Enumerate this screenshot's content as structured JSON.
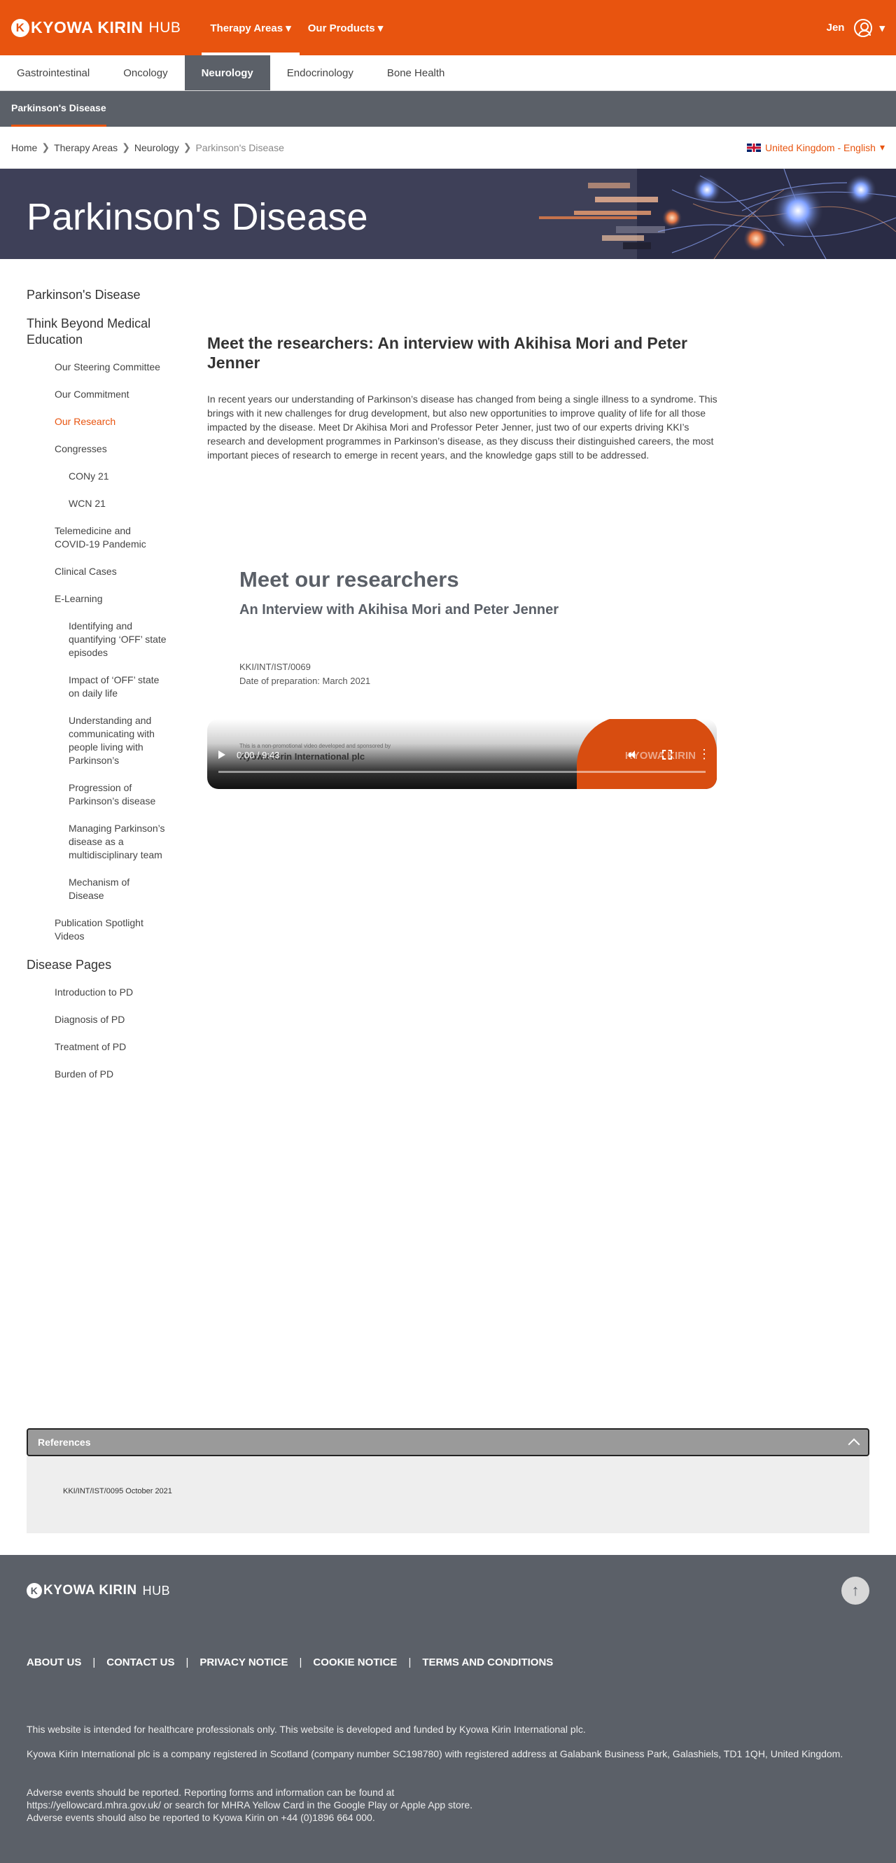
{
  "header": {
    "logo_brand": "KYOWA KIRIN",
    "logo_hub": "HUB",
    "nav": [
      {
        "label": "Therapy Areas ▾"
      },
      {
        "label": "Our Products ▾"
      }
    ],
    "user_name": "Jen",
    "user_caret": "▾"
  },
  "therapy_tabs": [
    "Gastrointestinal",
    "Oncology",
    "Neurology",
    "Endocrinology",
    "Bone Health"
  ],
  "subnav": {
    "item": "Parkinson's Disease"
  },
  "breadcrumb": {
    "items": [
      "Home",
      "Therapy Areas",
      "Neurology"
    ],
    "current": "Parkinson's Disease",
    "sep": "❯"
  },
  "locale": {
    "label": "United Kingdom - English",
    "caret": "▾"
  },
  "hero": {
    "title": "Parkinson's Disease"
  },
  "sidebar": {
    "parkinsons": "Parkinson's Disease",
    "think_beyond": "Think Beyond Medical Education",
    "steering": "Our Steering Committee",
    "commitment": "Our Commitment",
    "research": "Our Research",
    "congresses": "Congresses",
    "cony21": "CONy 21",
    "wcn21": "WCN 21",
    "telemedicine": "Telemedicine and COVID-19 Pandemic",
    "clinical_cases": "Clinical Cases",
    "elearning": "E-Learning",
    "el1": "Identifying and quantifying ‘OFF’ state episodes",
    "el2": "Impact of ‘OFF’ state on daily life",
    "el3": "Understanding and communicating with people living with Parkinson’s",
    "el4": "Progression of Parkinson’s disease",
    "el5": "Managing Parkinson’s disease as a multidisciplinary team",
    "el6": "Mechanism of Disease",
    "pub_spotlight": "Publication Spotlight Videos",
    "disease_pages": "Disease Pages",
    "intro_pd": "Introduction to PD",
    "diagnosis_pd": "Diagnosis of PD",
    "treatment_pd": "Treatment of PD",
    "burden_pd": "Burden of PD"
  },
  "article": {
    "title": "Meet the researchers: An interview with Akihisa Mori and Peter Jenner",
    "body": "In recent years our understanding of Parkinson’s disease has changed from being a single illness to a syndrome. This brings with it new challenges for drug development, but also new opportunities to improve quality of life for all those impacted by the disease. Meet Dr Akihisa Mori and Professor Peter Jenner, just two of our experts driving KKI’s research and development programmes in Parkinson’s disease, as they discuss their distinguished careers, the most important pieces of research to emerge in recent years, and the knowledge gaps still to be addressed."
  },
  "video": {
    "title": "Meet our researchers",
    "subtitle": "An Interview with Akihisa Mori and Peter Jenner",
    "code": "KKI/INT/IST/0069",
    "date": "Date of preparation: March 2021",
    "disclaimer": "This is a non-promotional video developed and sponsored by",
    "sponsor": "Kyowa Kirin International plc",
    "time": "0:00 / 9:43",
    "watermark": "KYOWA KIRIN",
    "progress": 0
  },
  "references": {
    "label": "References",
    "text": "KKI/INT/IST/0095 October 2021"
  },
  "footer": {
    "logo_brand": "KYOWA KIRIN",
    "logo_hub": "HUB",
    "top_arrow": "↑",
    "links": [
      "ABOUT US",
      "CONTACT US",
      "PRIVACY NOTICE",
      "COOKIE NOTICE",
      "TERMS AND CONDITIONS"
    ],
    "sep": "|",
    "p1": "This website is intended for healthcare professionals only. This website is developed and funded by Kyowa Kirin International plc.",
    "p2": "Kyowa Kirin International plc is a company registered in Scotland (company number SC198780) with registered address at Galabank Business Park, Galashiels, TD1 1QH, United Kingdom.",
    "p3a": "Adverse events should be reported. Reporting forms and information can be found at",
    "p3b": "https://yellowcard.mhra.gov.uk/ or search for MHRA Yellow Card in the Google Play or Apple App store.",
    "p3c": "Adverse events should also be reported to Kyowa Kirin on +44 (0)1896 664 000."
  },
  "colors": {
    "brand_orange": "#e8540f",
    "nav_gray": "#5b6068",
    "hero_navy": "#3e4058"
  }
}
